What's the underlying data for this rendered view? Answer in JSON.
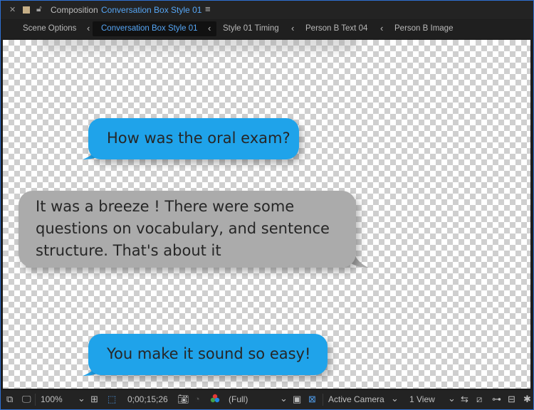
{
  "panel": {
    "label": "Composition",
    "composition_name": "Conversation Box Style 01",
    "menu_icon": "hamburger-icon"
  },
  "breadcrumbs": [
    {
      "label": "Scene Options"
    },
    {
      "label": "Conversation Box Style 01",
      "active": true
    },
    {
      "label": "Style 01 Timing"
    },
    {
      "label": "Person B Text 04"
    },
    {
      "label": "Person B Image"
    }
  ],
  "messages": [
    {
      "sender": "A",
      "color": "#1fa3ea",
      "lines": [
        "How was the oral exam?"
      ]
    },
    {
      "sender": "B",
      "color": "#ababab",
      "lines": [
        "It was a breeze ! There were some",
        "questions on vocabulary, and sentence",
        "structure. That's about it"
      ]
    },
    {
      "sender": "A",
      "color": "#1fa3ea",
      "lines": [
        "You make it sound so easy!"
      ]
    }
  ],
  "status": {
    "zoom": "100%",
    "timecode": "0;00;15;26",
    "resolution": "(Full)",
    "camera": "Active Camera",
    "view": "1 View"
  },
  "colors": {
    "accent": "#56a6f5",
    "panel_bg": "#232323",
    "bubble_blue": "#1fa3ea",
    "bubble_gray": "#ababab"
  }
}
